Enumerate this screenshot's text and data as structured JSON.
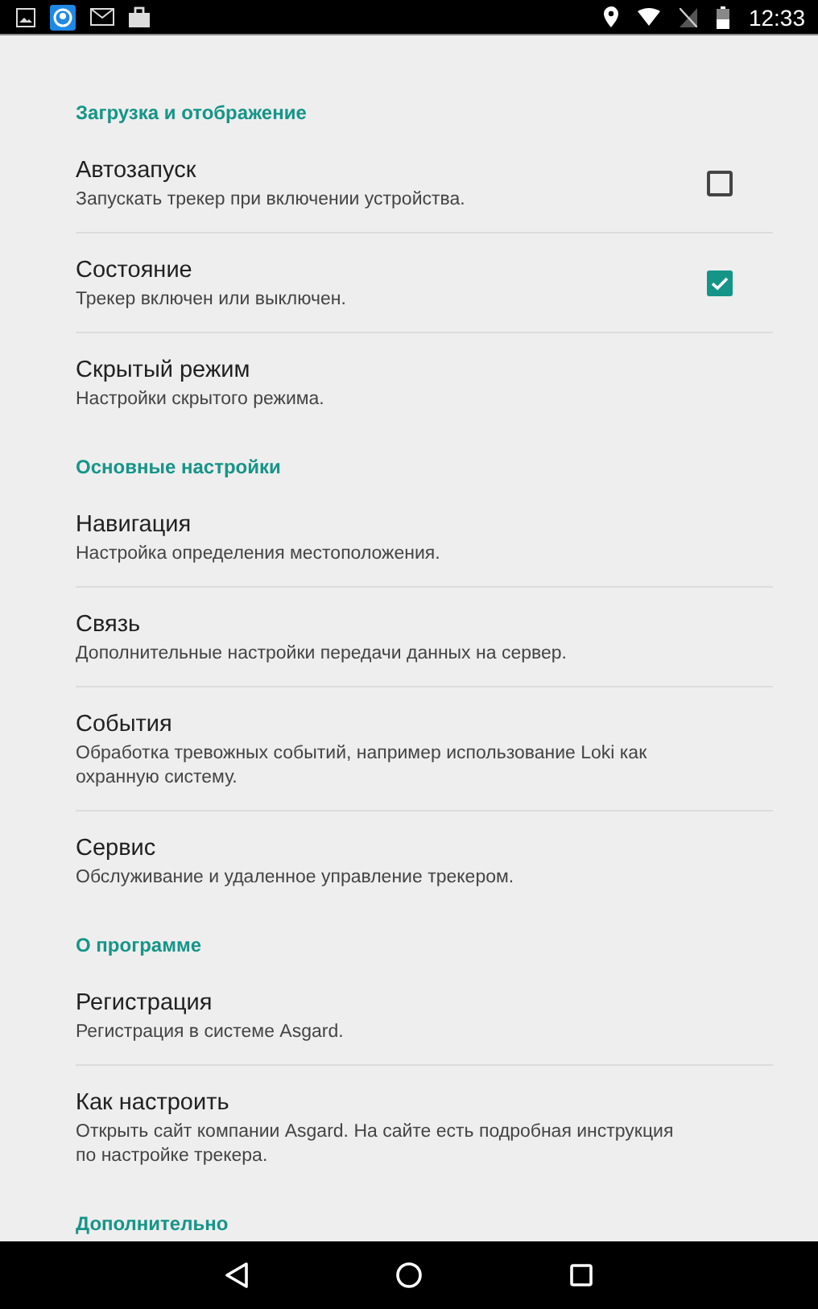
{
  "status_bar": {
    "time": "12:33"
  },
  "sections": [
    {
      "title": "Загрузка и отображение",
      "items": [
        {
          "kind": "checkbox",
          "title": "Автозапуск",
          "summary": "Запускать трекер при включении устройства.",
          "checked": false
        },
        {
          "kind": "checkbox",
          "title": "Состояние",
          "summary": "Трекер включен или выключен.",
          "checked": true
        },
        {
          "kind": "plain",
          "title": "Скрытый режим",
          "summary": "Настройки скрытого режима."
        }
      ]
    },
    {
      "title": "Основные настройки",
      "items": [
        {
          "kind": "plain",
          "title": "Навигация",
          "summary": "Настройка определения местоположения."
        },
        {
          "kind": "plain",
          "title": "Связь",
          "summary": "Дополнительные настройки передачи данных на сервер."
        },
        {
          "kind": "plain",
          "title": "События",
          "summary": "Обработка тревожных событий, например использование Loki как охранную систему."
        },
        {
          "kind": "plain",
          "title": "Сервис",
          "summary": "Обслуживание и удаленное управление трекером."
        }
      ]
    },
    {
      "title": "О программе",
      "items": [
        {
          "kind": "plain",
          "title": "Регистрация",
          "summary": "Регистрация в системе Asgard."
        },
        {
          "kind": "plain",
          "title": "Как настроить",
          "summary": "Открыть сайт компании Asgard. На сайте есть подробная инструкция по настройке трекера."
        }
      ]
    },
    {
      "title": "Дополнительно"
    }
  ]
}
